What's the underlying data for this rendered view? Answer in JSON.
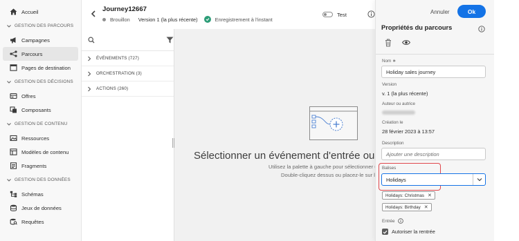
{
  "nav": {
    "items": [
      {
        "label": "Accueil",
        "icon": "home-icon"
      },
      {
        "section": "GESTION DES PARCOURS"
      },
      {
        "label": "Campagnes",
        "icon": "megaphone-icon"
      },
      {
        "label": "Parcours",
        "icon": "journey-icon",
        "active": true
      },
      {
        "label": "Pages de destination",
        "icon": "landing-page-icon"
      },
      {
        "section": "GESTION DES DÉCISIONS"
      },
      {
        "label": "Offres",
        "icon": "offers-icon"
      },
      {
        "label": "Composants",
        "icon": "components-icon"
      },
      {
        "section": "GESTION DE CONTENU"
      },
      {
        "label": "Ressources",
        "icon": "assets-icon"
      },
      {
        "label": "Modèles de contenu",
        "icon": "templates-icon"
      },
      {
        "label": "Fragments",
        "icon": "fragments-icon"
      },
      {
        "section": "GESTION DES DONNÉES"
      },
      {
        "label": "Schémas",
        "icon": "schema-icon"
      },
      {
        "label": "Jeux de données",
        "icon": "datasets-icon"
      },
      {
        "label": "Requêtes",
        "icon": "queries-icon"
      }
    ]
  },
  "header": {
    "title": "Journey12667",
    "status": "Brouillon",
    "version": "Version 1 (la plus récente)",
    "saved": "Enregistrement à l'instant",
    "test_label": "Test"
  },
  "palette": {
    "search_placeholder": "",
    "groups": [
      "ÉVÉNEMENTS (727)",
      "ORCHESTRATION (3)",
      "ACTIONS (260)"
    ]
  },
  "canvas": {
    "title": "Sélectionner un événement d'entrée ou une",
    "line1": "Utilisez la palette à gauche pour sélectionner un évé",
    "line2": "Double-cliquez dessus ou placez-le sur la zone"
  },
  "props": {
    "cancel": "Annuler",
    "ok": "Ok",
    "title": "Propriétés du parcours",
    "name_label": "Nom ∗",
    "name_value": "Holiday sales journey",
    "version_label": "Version",
    "version_value": "v. 1 (la plus récente)",
    "author_label": "Auteur ou autrice",
    "created_label": "Création le",
    "created_value": "28 février 2023 à 13:57",
    "description_label": "Description",
    "description_placeholder": "Ajouter une description",
    "tags_label": "Balises",
    "tags_input": "Holidays",
    "chips": [
      "Holidays: Christmas",
      "Holidays: Birthday"
    ],
    "entry_label": "Entrée",
    "allow_reentry": "Autoriser la rentrée"
  },
  "colors": {
    "accent": "#1473e6",
    "saved_green": "#2d9d78",
    "highlight_red": "#e0474d"
  }
}
